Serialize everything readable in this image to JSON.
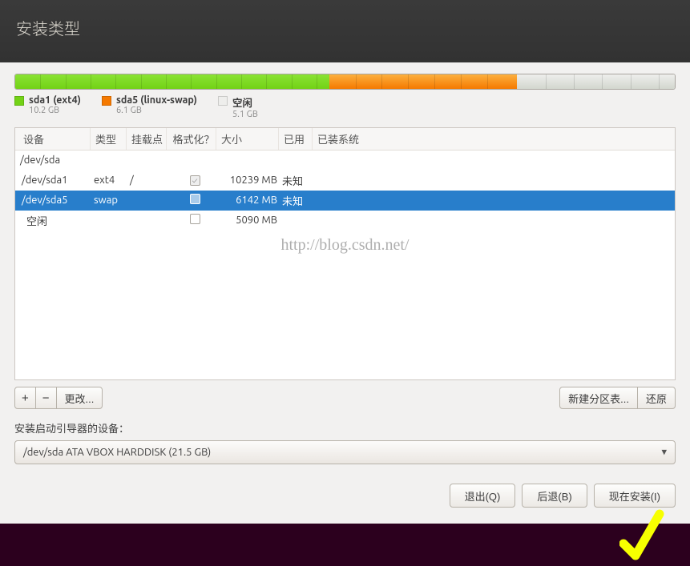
{
  "header": {
    "title": "安装类型"
  },
  "diskbar": {
    "segments": [
      {
        "class": "green",
        "pct": 47.6
      },
      {
        "class": "orange",
        "pct": 28.5
      },
      {
        "class": "gray",
        "pct": 23.9
      }
    ]
  },
  "legend": [
    {
      "swatch": "green",
      "name": "sda1 (ext4)",
      "size": "10.2 GB"
    },
    {
      "swatch": "orange",
      "name": "sda5 (linux-swap)",
      "size": "6.1 GB"
    },
    {
      "swatch": "gray",
      "name": "空闲",
      "size": "5.1 GB"
    }
  ],
  "columns": {
    "device": "设备",
    "type": "类型",
    "mount": "挂载点",
    "format": "格式化？",
    "size": "大小",
    "used": "已用",
    "system": "已装系统"
  },
  "rows": [
    {
      "device": "/dev/sda",
      "disk": true
    },
    {
      "device": "/dev/sda1",
      "type": "ext4",
      "mount": "/",
      "format_checked": true,
      "format_disabled": true,
      "size": "10239 MB",
      "used": "未知"
    },
    {
      "device": "/dev/sda5",
      "type": "swap",
      "mount": "",
      "format_checked": false,
      "size": "6142 MB",
      "used": "未知",
      "selected": true
    },
    {
      "device": "空闲",
      "type": "",
      "mount": "",
      "format_checked": false,
      "size": "5090 MB",
      "used": ""
    }
  ],
  "toolbar": {
    "add": "+",
    "remove": "−",
    "change": "更改...",
    "new_table": "新建分区表...",
    "revert": "还原"
  },
  "bootloader": {
    "label": "安装启动引导器的设备：",
    "value": "/dev/sda   ATA VBOX HARDDISK (21.5 GB)"
  },
  "footer": {
    "quit": "退出(Q)",
    "back": "后退(B)",
    "install": "现在安装(I)"
  },
  "watermark": "http://blog.csdn.net/"
}
